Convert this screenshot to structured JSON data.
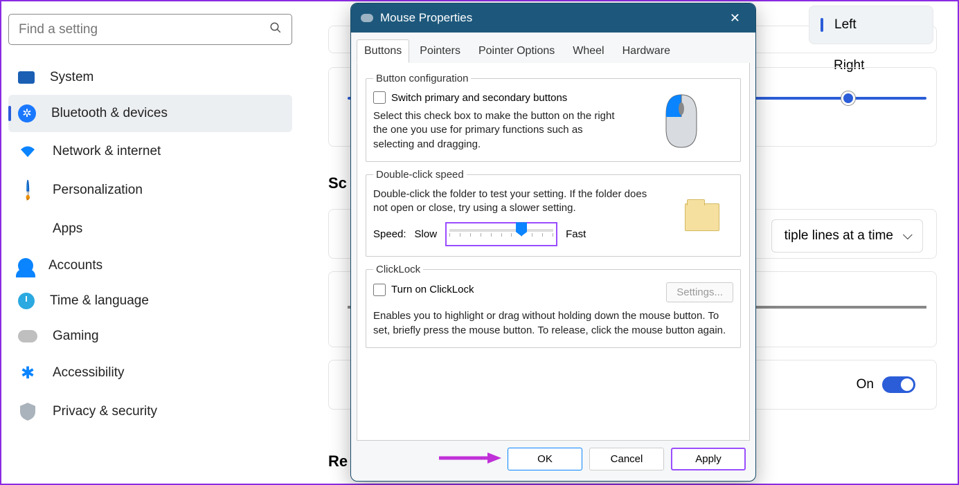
{
  "search": {
    "placeholder": "Find a setting"
  },
  "sidebar": {
    "items": [
      {
        "label": "System"
      },
      {
        "label": "Bluetooth & devices"
      },
      {
        "label": "Network & internet"
      },
      {
        "label": "Personalization"
      },
      {
        "label": "Apps"
      },
      {
        "label": "Accounts"
      },
      {
        "label": "Time & language"
      },
      {
        "label": "Gaming"
      },
      {
        "label": "Accessibility"
      },
      {
        "label": "Privacy & security"
      }
    ]
  },
  "main": {
    "primary_button": {
      "left": "Left",
      "right": "Right"
    },
    "section_scroll": "Sc",
    "scroll_dropdown": "tiple lines at a time",
    "toggle_label": "On",
    "section_related": "Re"
  },
  "dialog": {
    "title": "Mouse Properties",
    "tabs": [
      "Buttons",
      "Pointers",
      "Pointer Options",
      "Wheel",
      "Hardware"
    ],
    "active_tab": 0,
    "button_config": {
      "legend": "Button configuration",
      "checkbox": "Switch primary and secondary buttons",
      "desc": "Select this check box to make the button on the right the one you use for primary functions such as selecting and dragging."
    },
    "double_click": {
      "legend": "Double-click speed",
      "desc": "Double-click the folder to test your setting. If the folder does not open or close, try using a slower setting.",
      "speed_label": "Speed:",
      "slow": "Slow",
      "fast": "Fast"
    },
    "clicklock": {
      "legend": "ClickLock",
      "checkbox": "Turn on ClickLock",
      "settings_btn": "Settings...",
      "desc": "Enables you to highlight or drag without holding down the mouse button. To set, briefly press the mouse button. To release, click the mouse button again."
    },
    "buttons": {
      "ok": "OK",
      "cancel": "Cancel",
      "apply": "Apply"
    }
  }
}
